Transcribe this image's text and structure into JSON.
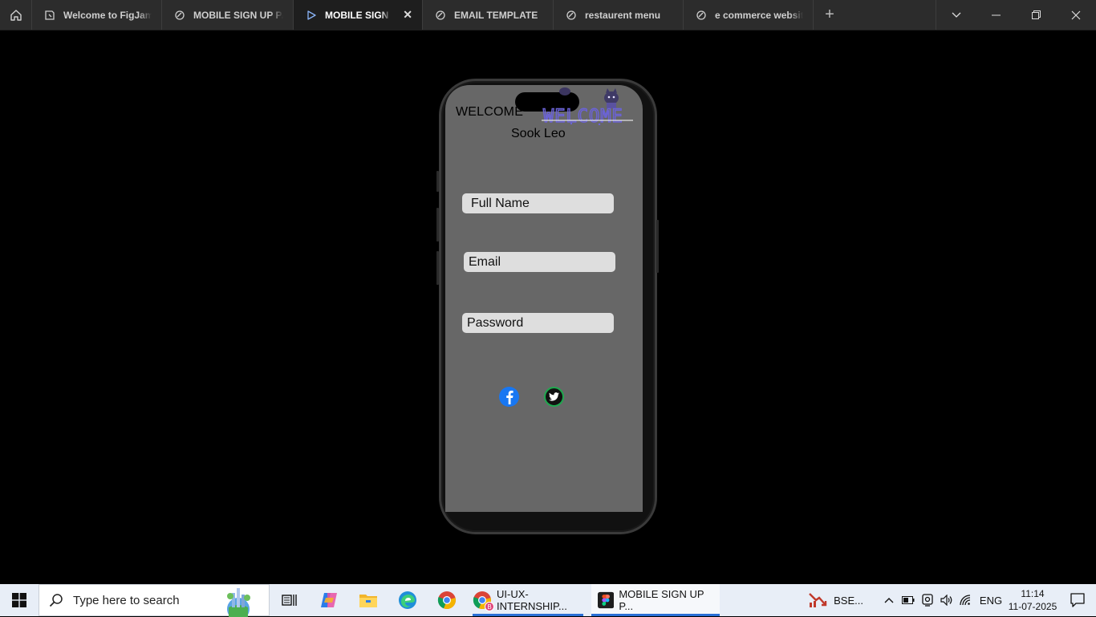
{
  "tabs": [
    {
      "label": "Welcome to FigJam",
      "icon": "figjam-file-icon"
    },
    {
      "label": "MOBILE SIGN UP PAGE",
      "icon": "design-file-icon"
    },
    {
      "label": "MOBILE SIGN UP",
      "icon": "prototype-play-icon",
      "active": true
    },
    {
      "label": "EMAIL TEMPLATE",
      "icon": "design-file-icon"
    },
    {
      "label": "restaurent menu",
      "icon": "design-file-icon"
    },
    {
      "label": "e commerce website u",
      "icon": "design-file-icon"
    }
  ],
  "phone": {
    "welcome_text": "WELCOME",
    "welcome_art_text": "WELCOME",
    "user_name": "Sook Leo",
    "fields": {
      "full_name": "Full Name",
      "email": "Email",
      "password": "Password"
    }
  },
  "taskbar": {
    "search_placeholder": "Type here to search",
    "apps": [
      {
        "label": "UI-UX-INTERNSHIP...",
        "icon": "chrome-profile-icon"
      },
      {
        "label": "MOBILE SIGN UP P...",
        "icon": "figma-icon"
      }
    ],
    "stock_label": "BSE...",
    "language": "ENG",
    "time": "11:14",
    "date": "11-07-2025"
  },
  "colors": {
    "accent": "#2a6fd6",
    "screen": "#676767",
    "facebook": "#1877f2",
    "twitter_ring": "#1fa84f"
  }
}
